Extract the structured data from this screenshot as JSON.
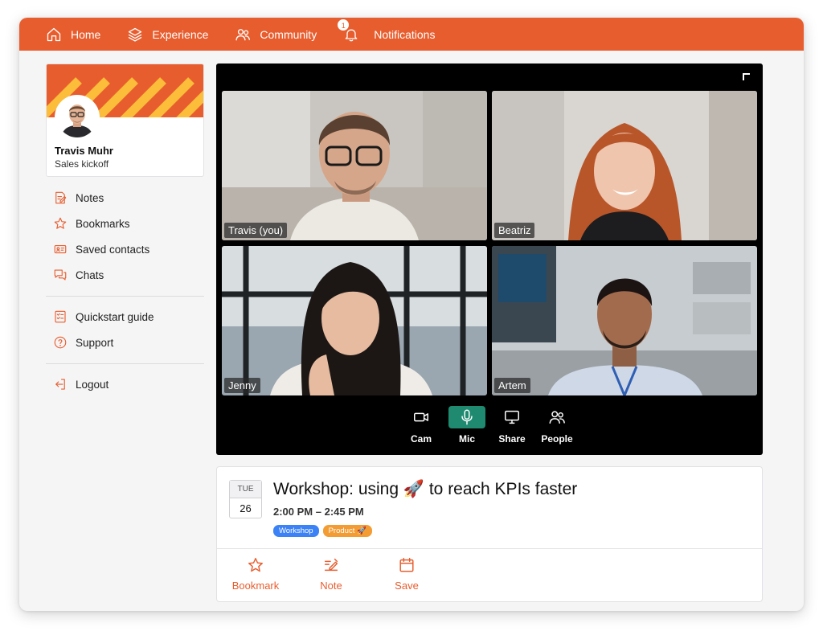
{
  "colors": {
    "accent": "#e85d2e",
    "accent_stripe": "#fbbd3a",
    "mic_active": "#1f8a70",
    "tag_workshop": "#3b82f6",
    "tag_product": "#f39c33"
  },
  "topnav": {
    "items": [
      {
        "label": "Home",
        "icon": "home-icon"
      },
      {
        "label": "Experience",
        "icon": "layers-icon"
      },
      {
        "label": "Community",
        "icon": "people-icon"
      },
      {
        "label": "Notifications",
        "icon": "bell-icon"
      }
    ],
    "notification_count": "1"
  },
  "profile": {
    "name": "Travis Muhr",
    "subtitle": "Sales kickoff"
  },
  "sidebar": {
    "group1": [
      {
        "label": "Notes",
        "icon": "notes-icon"
      },
      {
        "label": "Bookmarks",
        "icon": "star-icon"
      },
      {
        "label": "Saved contacts",
        "icon": "contact-card-icon"
      },
      {
        "label": "Chats",
        "icon": "chat-icon"
      }
    ],
    "group2": [
      {
        "label": "Quickstart guide",
        "icon": "checklist-icon"
      },
      {
        "label": "Support",
        "icon": "help-circle-icon"
      }
    ],
    "group3": [
      {
        "label": "Logout",
        "icon": "logout-icon"
      }
    ]
  },
  "call": {
    "participants": [
      {
        "label": "Travis (you)"
      },
      {
        "label": "Beatriz"
      },
      {
        "label": "Jenny"
      },
      {
        "label": "Artem"
      }
    ],
    "controls": [
      {
        "label": "Cam",
        "icon": "camera-icon",
        "active": false
      },
      {
        "label": "Mic",
        "icon": "mic-icon",
        "active": true
      },
      {
        "label": "Share",
        "icon": "monitor-icon",
        "active": false
      },
      {
        "label": "People",
        "icon": "people-icon",
        "active": false
      }
    ]
  },
  "event": {
    "day": "TUE",
    "date": "26",
    "title": "Workshop: using 🚀 to reach KPIs faster",
    "time": "2:00 PM – 2:45 PM",
    "tags": [
      "Workshop",
      "Product 🚀"
    ],
    "actions": [
      {
        "label": "Bookmark",
        "icon": "star-icon"
      },
      {
        "label": "Note",
        "icon": "edit-icon"
      },
      {
        "label": "Save",
        "icon": "calendar-icon"
      }
    ]
  }
}
